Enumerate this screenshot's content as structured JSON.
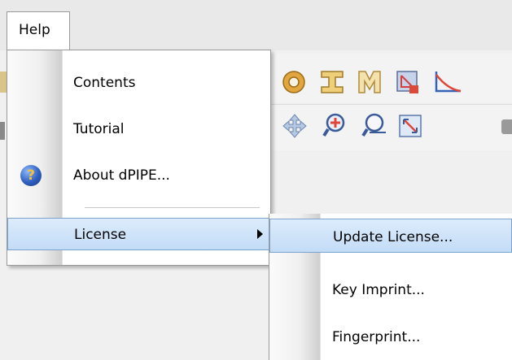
{
  "menubar": {
    "help_label": "Help"
  },
  "help_menu": {
    "items": [
      {
        "label": "Contents"
      },
      {
        "label": "Tutorial"
      },
      {
        "label": "About dPIPE...",
        "icon": "help-question-icon"
      },
      {
        "label": "License",
        "has_submenu": true,
        "highlighted": true
      }
    ]
  },
  "license_submenu": {
    "items": [
      {
        "label": "Update License...",
        "highlighted": true
      },
      {
        "label": "Key Imprint..."
      },
      {
        "label": "Fingerprint..."
      }
    ]
  },
  "colors": {
    "highlight_top": "#dcecfc",
    "highlight_bottom": "#c3dcf6",
    "highlight_border": "#7da2ce",
    "about_icon_blue": "#2f5fbf",
    "about_icon_glyph": "#f5c232"
  },
  "toolbar_icons": [
    "circle-icon",
    "i-beam-icon",
    "m-beam-icon",
    "warning-shape-icon",
    "angle-icon",
    "move-icon",
    "zoom-in-icon",
    "zoom-out-icon",
    "zoom-fit-icon"
  ]
}
